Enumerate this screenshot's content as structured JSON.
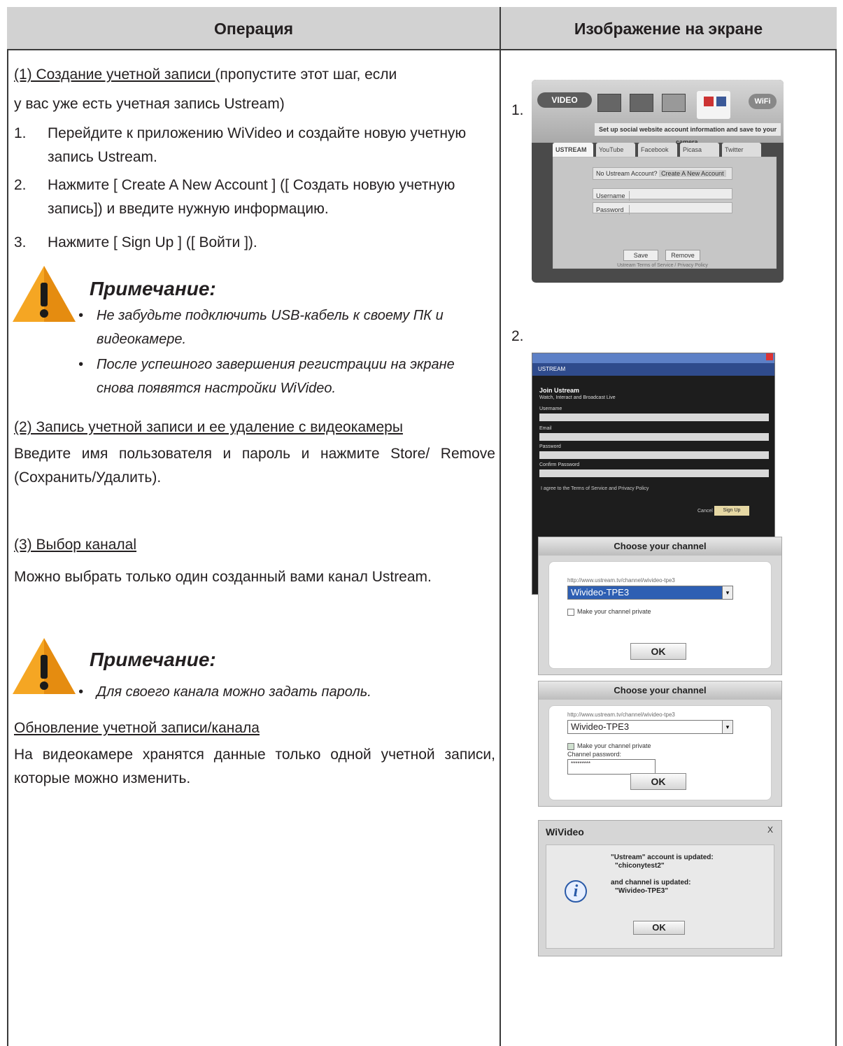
{
  "header": {
    "col_operation": "Операция",
    "col_screen": "Изображение на экране"
  },
  "section1": {
    "title": "(1) Создание учетной записи ",
    "title_tail": "(пропустите этот шаг, если",
    "line2": "у вас уже есть учетная запись Ustream)",
    "steps": [
      {
        "n": "1.",
        "text": "Перейдите к приложению WiVideo и создайте новую учетную запись Ustream."
      },
      {
        "n": "2.",
        "text": "Нажмите [ Create A New Account ] ([ Создать новую учетную запись]) и введите нужную информацию."
      },
      {
        "n": "3.",
        "text": "Нажмите [ Sign Up ] ([ Войти ])."
      }
    ],
    "note_title": "Примечание:",
    "note_items": [
      "Не забудьте подключить USB-кабель к своему ПК и видеокамере.",
      "После успешного завершения регистрации на экране снова появятся настройки WiVideo."
    ]
  },
  "section2": {
    "title": "(2) Запись учетной записи и ее удаление с видеокамеры",
    "text": "Введите имя пользователя и пароль и нажмите Store/ Remove (Сохранить/Удалить)."
  },
  "section3": {
    "title": "(3) Выбор каналаl",
    "text": "Можно выбрать только один созданный вами канал Ustream.",
    "note_title": "Примечание:",
    "note_items": [
      "Для своего канала можно задать пароль."
    ]
  },
  "section4": {
    "title": "Обновление учетной записи/канала",
    "text": "На видеокамере хранятся данные только одной учетной записи, которые можно изменить."
  },
  "right": {
    "num1": "1.",
    "num2": "2.",
    "shot1": {
      "logo": "VIDEO",
      "wifi": "WiFi",
      "band": "Set up social website account information and save to your camera.",
      "tabs": [
        "USTREAM",
        "YouTube",
        "Facebook",
        "Picasa",
        "Twitter"
      ],
      "no_account": "No Ustream Account?",
      "create_btn": "Create A New Account",
      "username": "Username",
      "password": "Password",
      "save": "Save",
      "remove": "Remove",
      "terms": "Ustream Terms of Service / Privacy Policy"
    },
    "shot2": {
      "head": "USTREAM",
      "join": "Join Ustream",
      "sub": "Watch, Interact and Broadcast Live",
      "fields": [
        "Username",
        "Email",
        "Password",
        "Confirm Password"
      ],
      "agree": "I agree to the Terms of Service and Privacy Policy",
      "cancel": "Cancel",
      "signup": "Sign Up"
    },
    "chan1": {
      "title": "Choose your channel",
      "url": "http://www.ustream.tv/channel/wivideo-tpe3",
      "value": "Wivideo-TPE3",
      "private": "Make your channel private",
      "ok": "OK"
    },
    "chan2": {
      "title": "Choose your channel",
      "url": "http://www.ustream.tv/channel/wivideo-tpe3",
      "value": "Wivideo-TPE3",
      "private": "Make your channel private",
      "pw_label": "Channel password:",
      "pw_value": "*********",
      "ok": "OK"
    },
    "msg": {
      "title": "WiVideo",
      "close": "X",
      "l1": "\"Ustream\" account is updated:",
      "l2": "\"chiconytest2\"",
      "l3": "and channel is updated:",
      "l4": "\"Wivideo-TPE3\"",
      "ok": "OK"
    }
  }
}
